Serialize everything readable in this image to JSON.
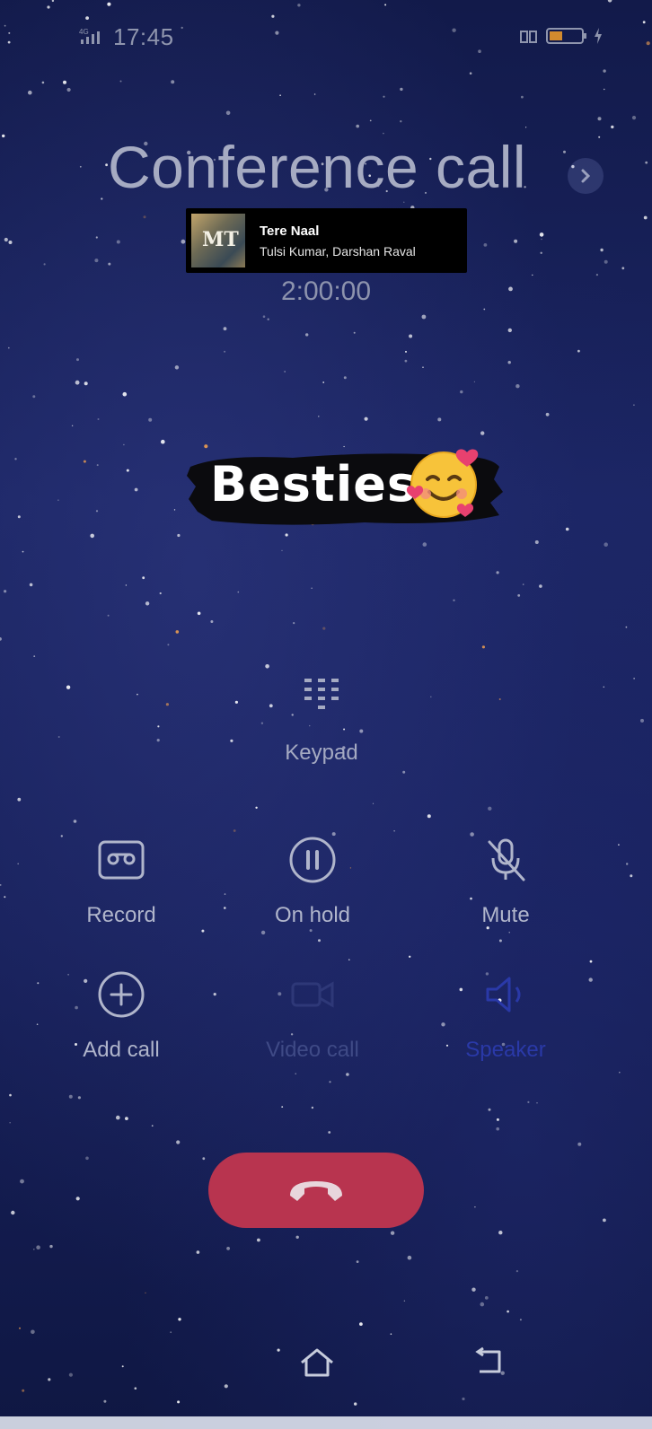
{
  "status_bar": {
    "time": "17:45"
  },
  "call": {
    "title": "Conference call",
    "duration": "2:00:00"
  },
  "music_overlay": {
    "album_mark": "MT",
    "song_title": "Tere Naal",
    "artist": "Tulsi Kumar, Darshan Raval"
  },
  "sticker": {
    "text": "Besties"
  },
  "keypad": {
    "label": "Keypad"
  },
  "actions": {
    "record": "Record",
    "on_hold": "On hold",
    "mute": "Mute",
    "add_call": "Add call",
    "video_call": "Video call",
    "speaker": "Speaker"
  },
  "colors": {
    "background": "#1b2563",
    "end_call": "#b8344f",
    "label": "#b0b5cb",
    "dimmed_label": "#3f4a86",
    "speaker_accent": "#2a39a8"
  },
  "icons": {
    "signal": "signal-icon",
    "battery": "battery-icon",
    "chevron": "chevron-right-icon",
    "keypad": "keypad-icon",
    "record": "record-cassette-icon",
    "hold": "pause-icon",
    "mute": "mic-off-icon",
    "add": "plus-circle-icon",
    "video": "video-icon",
    "speaker": "speaker-icon",
    "end": "phone-hangup-icon",
    "home": "home-icon",
    "back": "back-icon"
  }
}
